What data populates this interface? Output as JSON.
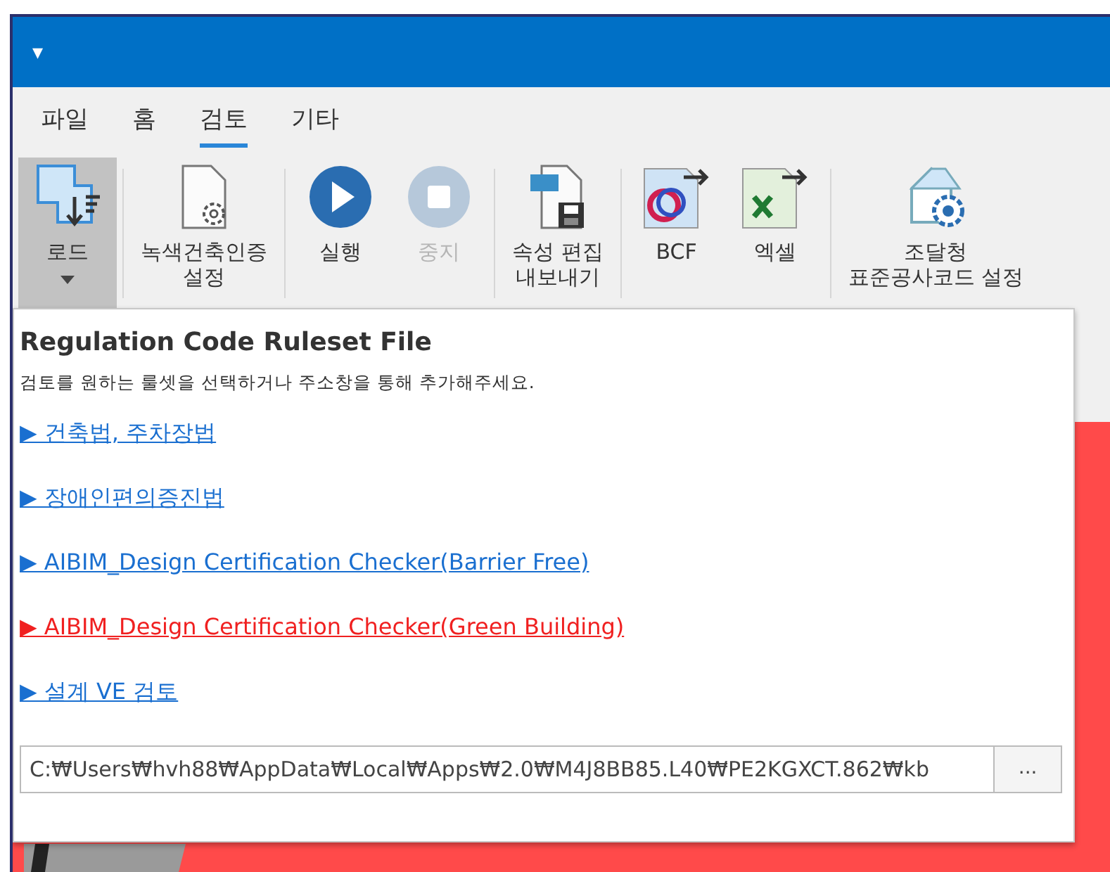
{
  "title_bar": {
    "menu_glyph": "▾"
  },
  "tabs": [
    {
      "label": "파일",
      "selected": false
    },
    {
      "label": "홈",
      "selected": false
    },
    {
      "label": "검토",
      "selected": true
    },
    {
      "label": "기타",
      "selected": false
    }
  ],
  "ribbon": [
    {
      "kind": "load",
      "label": "로드",
      "selected": true,
      "disabled": false,
      "dropdown": true
    },
    {
      "kind": "doc-gear",
      "label": "녹색건축인증\n설정",
      "selected": false,
      "disabled": false,
      "group_start": true
    },
    {
      "kind": "play",
      "label": "실행",
      "selected": false,
      "disabled": false,
      "group_start": true
    },
    {
      "kind": "stop",
      "label": "중지",
      "selected": false,
      "disabled": true
    },
    {
      "kind": "csv",
      "label": "속성 편집\n내보내기",
      "selected": false,
      "disabled": false,
      "group_start": true
    },
    {
      "kind": "bcf",
      "label": "BCF",
      "selected": false,
      "disabled": false,
      "group_start": true
    },
    {
      "kind": "excel",
      "label": "엑셀",
      "selected": false,
      "disabled": false
    },
    {
      "kind": "house-gear",
      "label": "조달청\n표준공사코드 설정",
      "selected": false,
      "disabled": false,
      "group_start": true
    }
  ],
  "popup": {
    "title": "Regulation Code Ruleset File",
    "hint": "검토를 원하는 룰셋을 선택하거나 주소창을 통해 추가해주세요.",
    "rulesets": [
      {
        "label": "건축법, 주차장법",
        "selected": false
      },
      {
        "label": "장애인편의증진법",
        "selected": false
      },
      {
        "label": "AIBIM_Design Certification Checker(Barrier Free)",
        "selected": false
      },
      {
        "label": "AIBIM_Design Certification Checker(Green Building)",
        "selected": true
      },
      {
        "label": "설계 VE 검토",
        "selected": false
      }
    ],
    "bullet": "▶",
    "path": "C:₩Users₩hvh88₩AppData₩Local₩Apps₩2.0₩M4J8BB85.L40₩PE2KGXCT.862₩kb",
    "browse_label": "..."
  }
}
